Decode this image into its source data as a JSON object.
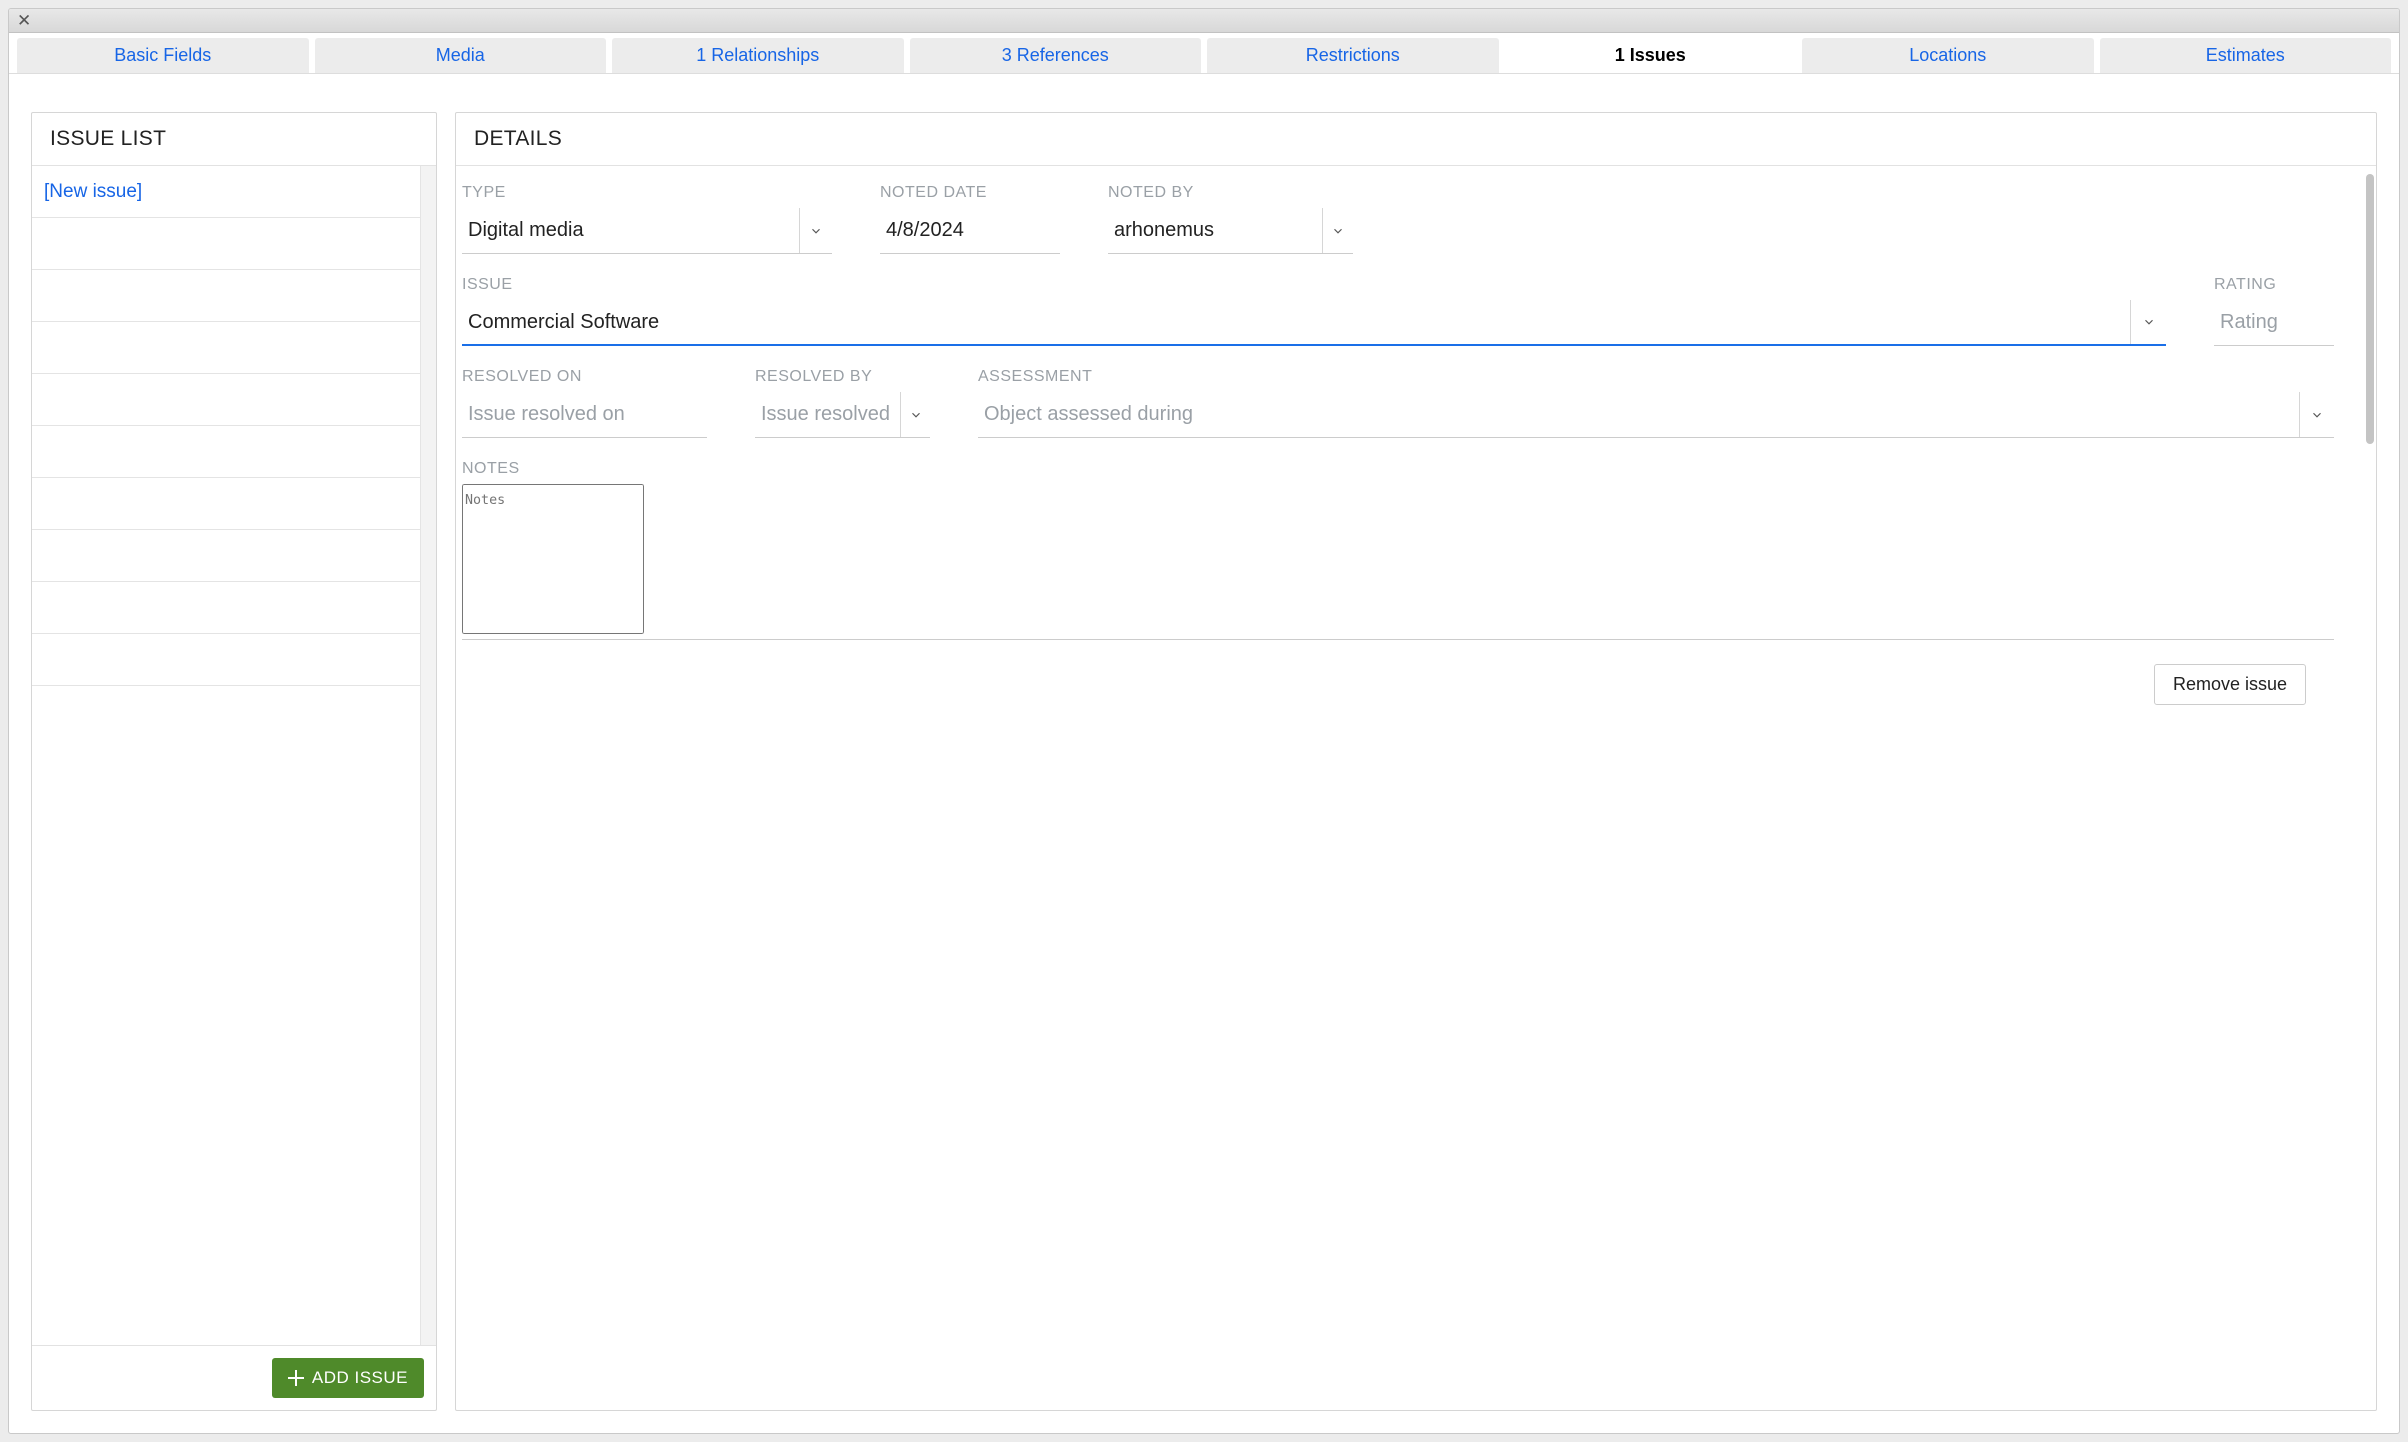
{
  "tabs": [
    {
      "label": "Basic Fields",
      "active": false
    },
    {
      "label": "Media",
      "active": false
    },
    {
      "label": "1 Relationships",
      "active": false
    },
    {
      "label": "3 References",
      "active": false
    },
    {
      "label": "Restrictions",
      "active": false
    },
    {
      "label": "1 Issues",
      "active": true
    },
    {
      "label": "Locations",
      "active": false
    },
    {
      "label": "Estimates",
      "active": false
    }
  ],
  "left": {
    "header": "ISSUE LIST",
    "items": [
      {
        "label": "[New issue]",
        "link": true
      }
    ],
    "empty_rows": 9,
    "add_button": "ADD ISSUE"
  },
  "right": {
    "header": "DETAILS",
    "labels": {
      "type": "TYPE",
      "noted_date": "NOTED DATE",
      "noted_by": "NOTED BY",
      "issue": "ISSUE",
      "rating": "RATING",
      "resolved_on": "RESOLVED ON",
      "resolved_by": "RESOLVED BY",
      "assessment": "ASSESSMENT",
      "notes": "NOTES"
    },
    "values": {
      "type": "Digital media",
      "noted_date": "4/8/2024",
      "noted_by": "arhonemus",
      "issue": "Commercial Software",
      "rating": "",
      "resolved_on": "",
      "resolved_by": "",
      "assessment": "",
      "notes": ""
    },
    "placeholders": {
      "rating": "Rating",
      "resolved_on": "Issue resolved on",
      "resolved_by": "Issue resolved by",
      "assessment": "Object assessed during",
      "notes": "Notes"
    },
    "remove_button": "Remove issue"
  }
}
